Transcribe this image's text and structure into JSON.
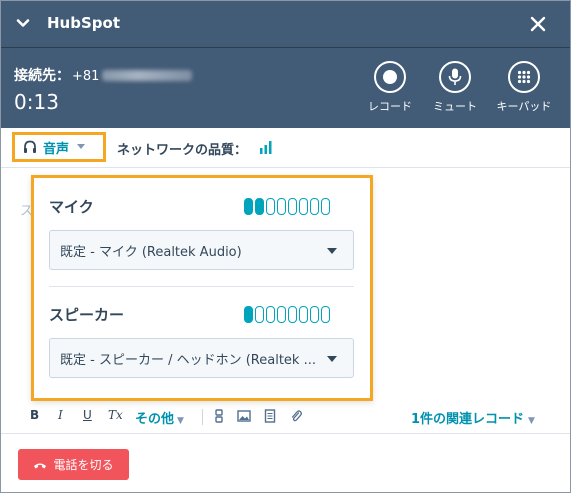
{
  "window": {
    "title": "HubSpot"
  },
  "call": {
    "connection_label": "接続先：",
    "number_prefix": "+81",
    "timer": "0:13",
    "controls": [
      {
        "label": "レコード",
        "icon": "record-icon"
      },
      {
        "label": "ミュート",
        "icon": "microphone-icon"
      },
      {
        "label": "キーパッド",
        "icon": "keypad-icon"
      }
    ]
  },
  "toolbar": {
    "audio_label": "音声",
    "network_quality_label": "ネットワークの品質："
  },
  "notes": {
    "placeholder_fragment": "ス"
  },
  "audio_popover": {
    "mic": {
      "label": "マイク",
      "level_segments_on": 2,
      "level_segments_total": 8,
      "selected": "既定 - マイク (Realtek Audio)"
    },
    "speaker": {
      "label": "スピーカー",
      "level_segments_on": 1,
      "level_segments_total": 8,
      "selected": "既定 - スピーカー / ヘッドホン (Realtek ..."
    }
  },
  "formatting": {
    "bold": "B",
    "italic": "I",
    "underline": "U",
    "clear_format": "Tx",
    "more_label": "その他",
    "related_records": "1件の関連レコード"
  },
  "footer": {
    "hangup_label": "電話を切る"
  },
  "colors": {
    "header_bg": "#425b76",
    "accent_teal": "#00a4bd",
    "link": "#0091ae",
    "highlight_border": "#f5a623",
    "hangup": "#f2545b"
  }
}
